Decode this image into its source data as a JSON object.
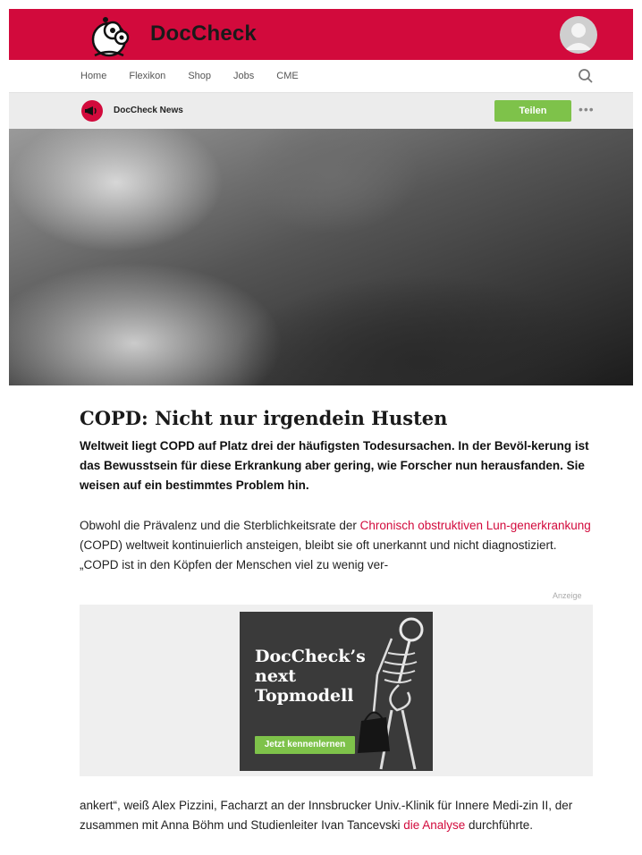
{
  "header": {
    "brand": "DocCheck",
    "colors": {
      "brand_red": "#d20a3c",
      "accent_green": "#7ec24a"
    }
  },
  "nav": {
    "items": [
      "Home",
      "Flexikon",
      "Shop",
      "Jobs",
      "CME"
    ]
  },
  "news": {
    "label": "DocCheck News",
    "share_label": "Teilen",
    "more_label": "•••"
  },
  "article": {
    "title": "COPD: Nicht nur irgendein Husten",
    "lead": "Weltweit liegt COPD auf Platz drei der häufigsten Todesursachen. In der Bevöl-kerung ist das Bewusstsein für diese Erkrankung aber gering, wie Forscher nun herausfanden. Sie weisen auf ein bestimmtes Problem hin.",
    "body1_prefix": "Obwohl die Prävalenz und die Sterblichkeitsrate der ",
    "body1_link": "Chronisch obstruktiven Lun-generkrankung",
    "body1_suffix": " (COPD) weltweit kontinuierlich ansteigen, bleibt sie oft unerkannt und nicht diagnostiziert. „COPD ist in den Köpfen der Menschen viel zu wenig ver-",
    "body2_prefix": "ankert“, weiß Alex Pizzini, Facharzt an der Innsbrucker Univ.-Klinik für Innere Medi-zin II, der zusammen mit Anna Böhm und Studienleiter Ivan Tancevski ",
    "body2_link": "die Analyse",
    "body2_suffix": " durchführte."
  },
  "ad": {
    "label": "Anzeige",
    "headline": "DocCheck’s next Topmodell",
    "button": "Jetzt kennenlernen"
  }
}
